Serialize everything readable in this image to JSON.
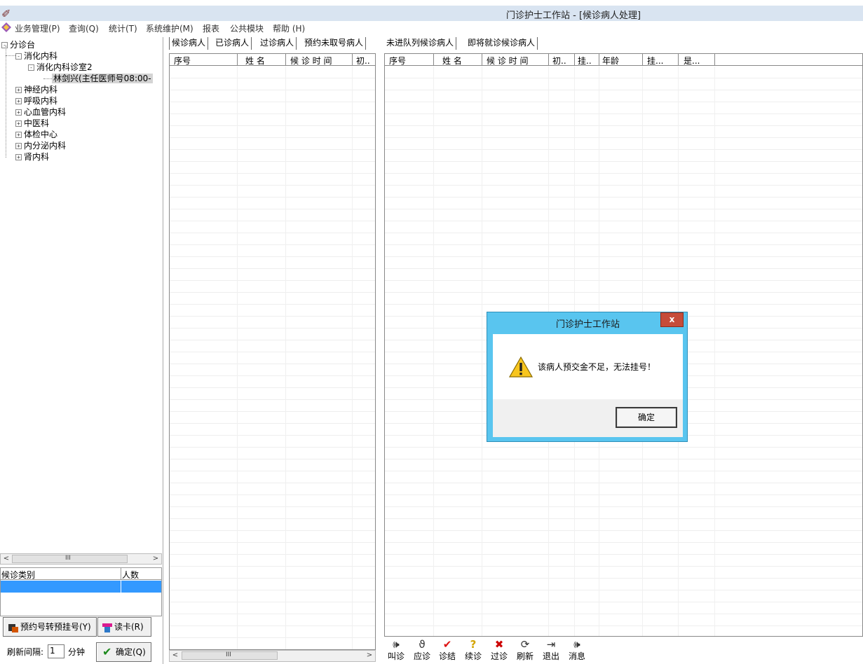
{
  "window": {
    "title": "门诊护士工作站 - [候诊病人处理]",
    "logo_icon": "app-logo-icon"
  },
  "menu": [
    "业务管理(P)",
    "查询(Q)",
    "统计(T)",
    "系统维护(M)",
    "报表",
    "公共模块",
    "帮助 (H)"
  ],
  "tree": {
    "root": "分诊台",
    "dept": "消化内科",
    "clinic": "消化内科诊室2",
    "doctor": "林剑兴(主任医师号08:00-",
    "others": [
      "神经内科",
      "呼吸内科",
      "心血管内科",
      "中医科",
      "体检中心",
      "内分泌内科",
      "肾内科"
    ]
  },
  "left_hscroll_grip": "III",
  "category_table": {
    "headers": [
      "候诊类别",
      "人数"
    ]
  },
  "buttons": {
    "convert": "预约号转预挂号(Y)",
    "read_card": "读卡(R)",
    "confirm": "确定(Q)"
  },
  "refresh": {
    "label": "刷新间隔:",
    "value": "1",
    "unit": "分钟"
  },
  "mid_tabs": [
    "候诊病人",
    "已诊病人",
    "过诊病人",
    "预约未取号病人"
  ],
  "mid_grid_headers": [
    "序号",
    "姓  名",
    "候 诊 时 间",
    "初.."
  ],
  "right_tabs": [
    "未进队列候诊病人",
    "即将就诊候诊病人"
  ],
  "right_grid_headers": [
    "序号",
    "姓  名",
    "候 诊 时 间",
    "初..",
    "挂..",
    "年龄",
    "挂...",
    "是..."
  ],
  "toolbar": [
    {
      "label": "叫诊",
      "icon": "speaker-icon"
    },
    {
      "label": "应诊",
      "icon": "stethoscope-icon"
    },
    {
      "label": "诊结",
      "icon": "checkmark-icon"
    },
    {
      "label": "续诊",
      "icon": "question-icon"
    },
    {
      "label": "过诊",
      "icon": "cross-icon"
    },
    {
      "label": "刷新",
      "icon": "refresh-icon"
    },
    {
      "label": "退出",
      "icon": "exit-door-icon"
    },
    {
      "label": "消息",
      "icon": "message-speaker-icon"
    }
  ],
  "dialog": {
    "title": "门诊护士工作站",
    "close": "x",
    "message": "该病人预交金不足，无法挂号！",
    "ok": "确定"
  },
  "colors": {
    "selection": "#3399ff",
    "dialog_frame": "#59c5ef",
    "close_button": "#c64c3a",
    "title_band": "#d9e4f1"
  }
}
